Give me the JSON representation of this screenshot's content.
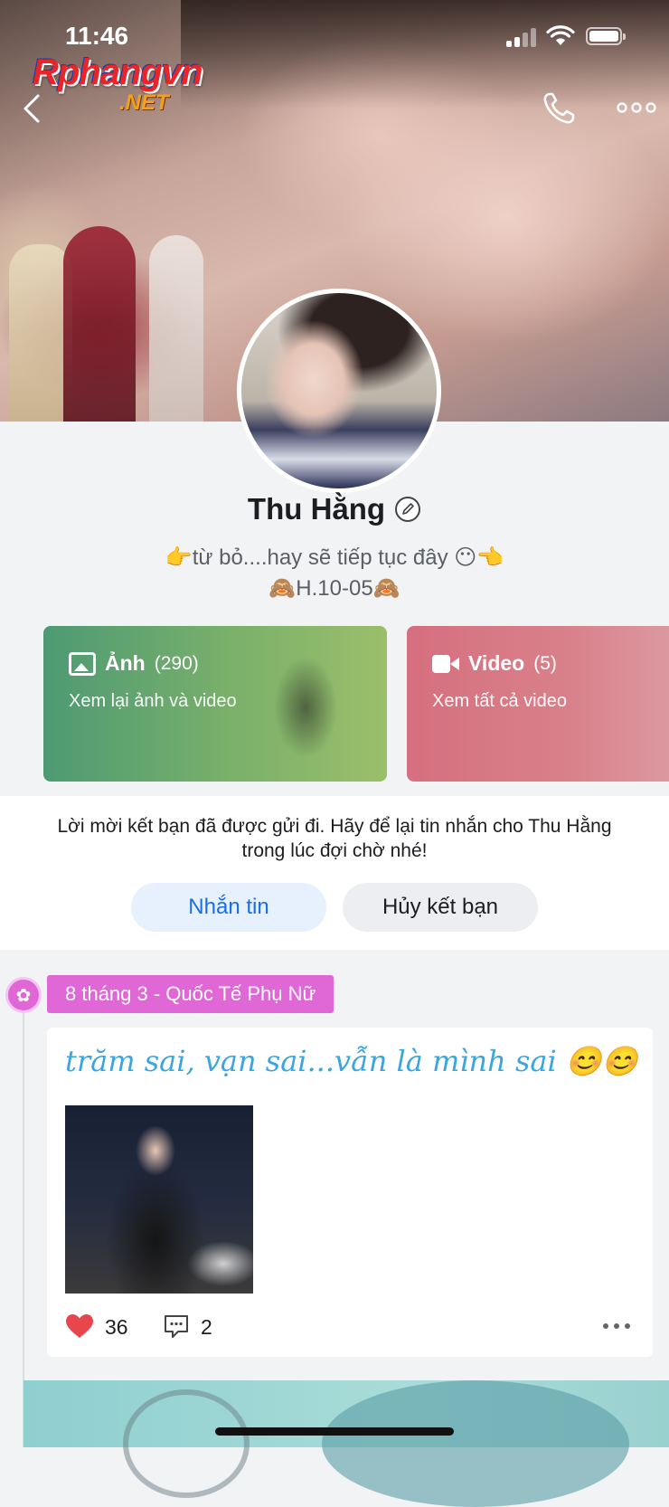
{
  "status_bar": {
    "time": "11:46"
  },
  "watermark": {
    "main": "Rphangvn",
    "sub": ".NET"
  },
  "profile": {
    "name": "Thu Hằng",
    "bio_line1": "👉từ bỏ....hay sẽ tiếp tục đây 😶👈",
    "bio_line2": "🙈H.10-05🙈"
  },
  "media": {
    "photos": {
      "label": "Ảnh",
      "count": "(290)",
      "subtitle": "Xem lại ảnh và video"
    },
    "videos": {
      "label": "Video",
      "count": "(5)",
      "subtitle": "Xem tất cả video"
    }
  },
  "friend_request": {
    "message": "Lời mời kết bạn đã được gửi đi. Hãy để lại tin nhắn cho Thu Hằng trong lúc đợi chờ nhé!",
    "message_button": "Nhắn tin",
    "cancel_button": "Hủy kết bạn"
  },
  "timeline": {
    "event_label": "8 tháng 3 - Quốc Tế Phụ Nữ",
    "post": {
      "text": "trăm sai, vạn sai...vẫn là mình sai 😊😊",
      "likes": "36",
      "comments": "2"
    }
  },
  "colors": {
    "accent_blue": "#1a6ee8",
    "event_pink": "#e067d6",
    "like_red": "#e8454d",
    "post_text_blue": "#3aa6e0"
  },
  "icons": [
    "back-icon",
    "phone-icon",
    "more-icon",
    "edit-icon",
    "image-icon",
    "video-camera-icon",
    "rose-icon",
    "heart-icon",
    "comment-icon"
  ]
}
